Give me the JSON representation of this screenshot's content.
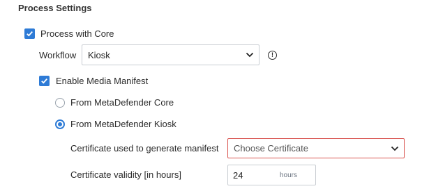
{
  "section": {
    "title": "Process Settings"
  },
  "process_with_core": {
    "label": "Process with Core",
    "checked": true
  },
  "workflow": {
    "label": "Workflow",
    "value": "Kiosk",
    "info_icon": "info-circle-icon"
  },
  "media_manifest": {
    "label": "Enable Media Manifest",
    "checked": true
  },
  "source": {
    "options": [
      {
        "label": "From MetaDefender Core",
        "selected": false
      },
      {
        "label": "From MetaDefender Kiosk",
        "selected": true
      }
    ]
  },
  "certificate": {
    "label": "Certificate used to generate manifest",
    "placeholder": "Choose Certificate",
    "error_color": "#d9534f"
  },
  "validity": {
    "label": "Certificate validity [in hours]",
    "value": "24",
    "unit": "hours"
  },
  "colors": {
    "accent": "#2e7bd6"
  }
}
